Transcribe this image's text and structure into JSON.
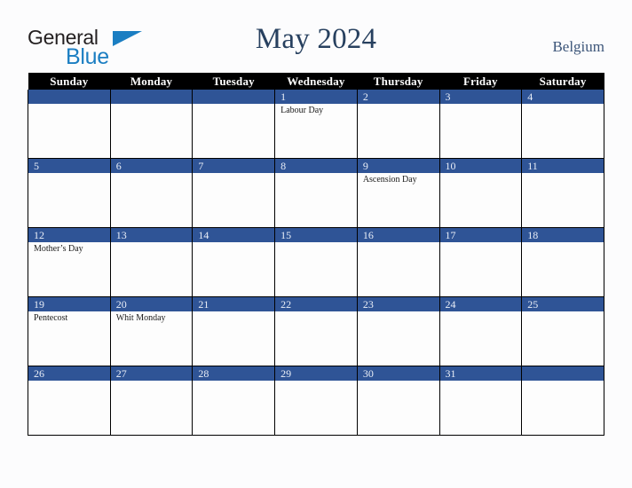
{
  "brand": {
    "line1": "General",
    "line2": "Blue",
    "triangle_icon": "triangle-right-icon",
    "text_color": "#231f20",
    "accent_color": "#1b7ec2"
  },
  "header": {
    "title": "May 2024",
    "country": "Belgium",
    "title_color": "#27405f"
  },
  "theme": {
    "header_row_bg": "#000000",
    "header_row_text": "#ffffff",
    "day_bar_bg": "#2f5496",
    "day_bar_text": "#e9eef7",
    "cell_bg": "#fdfdfd",
    "grid_line": "#000000",
    "page_bg": "#fcfcfd"
  },
  "weekdays": [
    "Sunday",
    "Monday",
    "Tuesday",
    "Wednesday",
    "Thursday",
    "Friday",
    "Saturday"
  ],
  "weeks": [
    [
      {
        "date": "",
        "events": []
      },
      {
        "date": "",
        "events": []
      },
      {
        "date": "",
        "events": []
      },
      {
        "date": "1",
        "events": [
          "Labour Day"
        ]
      },
      {
        "date": "2",
        "events": []
      },
      {
        "date": "3",
        "events": []
      },
      {
        "date": "4",
        "events": []
      }
    ],
    [
      {
        "date": "5",
        "events": []
      },
      {
        "date": "6",
        "events": []
      },
      {
        "date": "7",
        "events": []
      },
      {
        "date": "8",
        "events": []
      },
      {
        "date": "9",
        "events": [
          "Ascension Day"
        ]
      },
      {
        "date": "10",
        "events": []
      },
      {
        "date": "11",
        "events": []
      }
    ],
    [
      {
        "date": "12",
        "events": [
          "Mother’s Day"
        ]
      },
      {
        "date": "13",
        "events": []
      },
      {
        "date": "14",
        "events": []
      },
      {
        "date": "15",
        "events": []
      },
      {
        "date": "16",
        "events": []
      },
      {
        "date": "17",
        "events": []
      },
      {
        "date": "18",
        "events": []
      }
    ],
    [
      {
        "date": "19",
        "events": [
          "Pentecost"
        ]
      },
      {
        "date": "20",
        "events": [
          "Whit Monday"
        ]
      },
      {
        "date": "21",
        "events": []
      },
      {
        "date": "22",
        "events": []
      },
      {
        "date": "23",
        "events": []
      },
      {
        "date": "24",
        "events": []
      },
      {
        "date": "25",
        "events": []
      }
    ],
    [
      {
        "date": "26",
        "events": []
      },
      {
        "date": "27",
        "events": []
      },
      {
        "date": "28",
        "events": []
      },
      {
        "date": "29",
        "events": []
      },
      {
        "date": "30",
        "events": []
      },
      {
        "date": "31",
        "events": []
      },
      {
        "date": "",
        "events": []
      }
    ]
  ]
}
